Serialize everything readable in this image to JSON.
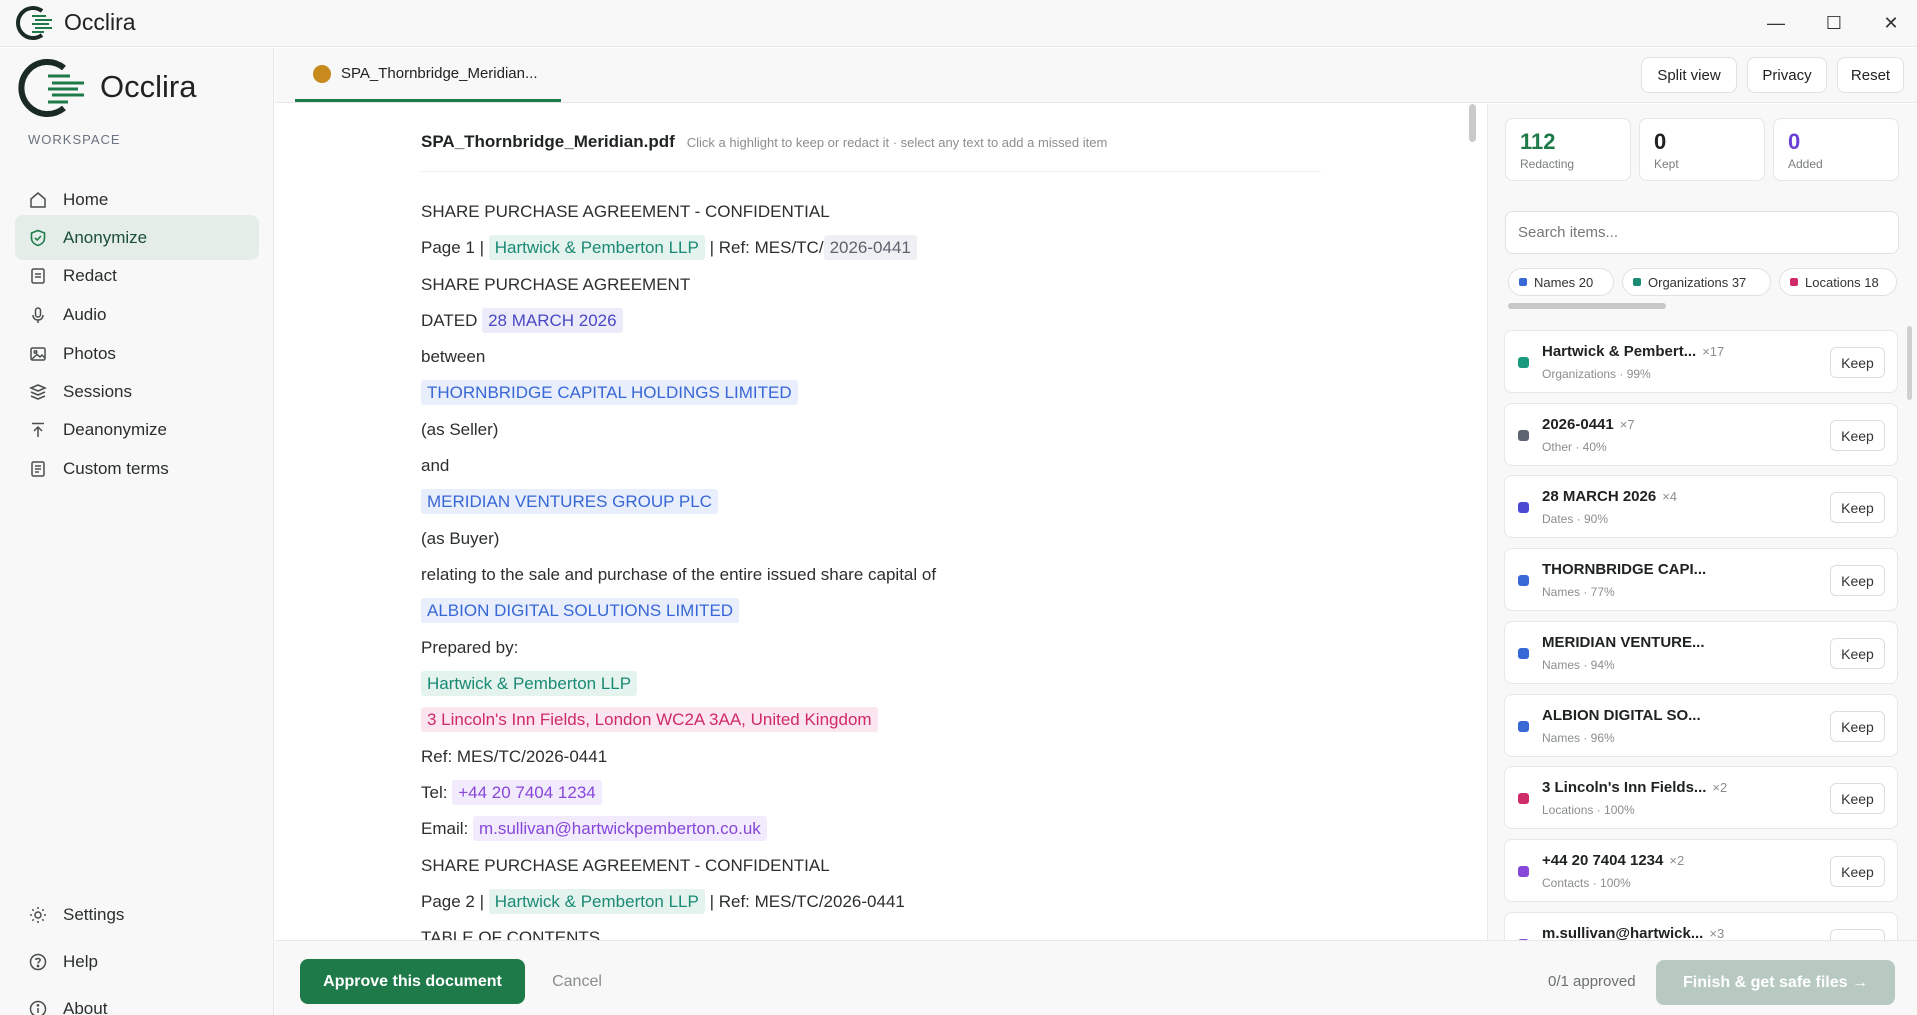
{
  "app": {
    "title": "Occlira"
  },
  "window_controls": {
    "minimize": "—",
    "maximize": "☐",
    "close": "✕"
  },
  "sidebar": {
    "brand": "Occlira",
    "section_label": "WORKSPACE",
    "nav": [
      {
        "label": "Home",
        "icon": "home-icon"
      },
      {
        "label": "Anonymize",
        "icon": "shield-icon",
        "active": true
      },
      {
        "label": "Redact",
        "icon": "document-icon"
      },
      {
        "label": "Audio",
        "icon": "microphone-icon"
      },
      {
        "label": "Photos",
        "icon": "image-icon"
      },
      {
        "label": "Sessions",
        "icon": "stack-icon"
      },
      {
        "label": "Deanonymize",
        "icon": "upload-icon"
      },
      {
        "label": "Custom terms",
        "icon": "list-icon"
      }
    ],
    "bottom": [
      {
        "label": "Settings",
        "icon": "sun-icon"
      },
      {
        "label": "Help",
        "icon": "help-icon"
      },
      {
        "label": "About",
        "icon": "info-icon"
      }
    ]
  },
  "tabs": {
    "active_doc": "SPA_Thornbridge_Meridian...",
    "dot_color": "#c98a1d"
  },
  "top_actions": {
    "split_view": "Split view",
    "privacy": "Privacy",
    "reset": "Reset"
  },
  "document": {
    "filename": "SPA_Thornbridge_Meridian.pdf",
    "hint": "Click a highlight to keep or redact it · select any text to add a missed item",
    "lines": [
      "SHARE PURCHASE AGREEMENT - CONFIDENTIAL",
      {
        "pre": "Page 1 | ",
        "org": "Hartwick & Pemberton LLP",
        "mid": " | Ref: MES/TC/",
        "other": "2026-0441"
      },
      "SHARE PURCHASE AGREEMENT",
      {
        "pre": "DATED ",
        "date": "28 MARCH 2026"
      },
      "between",
      {
        "name": "THORNBRIDGE CAPITAL HOLDINGS LIMITED"
      },
      "(as Seller)",
      "and",
      {
        "name": "MERIDIAN VENTURES GROUP PLC"
      },
      "(as Buyer)",
      "relating to the sale and purchase of the entire issued share capital of",
      {
        "name": "ALBION DIGITAL SOLUTIONS LIMITED"
      },
      "Prepared by:",
      {
        "org": "Hartwick & Pemberton LLP"
      },
      {
        "loc": "3 Lincoln's Inn Fields, London WC2A 3AA, United Kingdom"
      },
      "Ref: MES/TC/2026-0441",
      {
        "pre": "Tel: ",
        "contact": "+44 20 7404 1234"
      },
      {
        "pre": "Email: ",
        "contact": "m.sullivan@hartwickpemberton.co.uk"
      },
      "SHARE PURCHASE AGREEMENT - CONFIDENTIAL",
      {
        "pre": "Page 2 | ",
        "org": "Hartwick & Pemberton LLP",
        "mid": " | Ref: MES/TC/2026-0441"
      },
      "TABLE OF CONTENTS"
    ]
  },
  "stats": {
    "redacting": {
      "value": "112",
      "label": "Redacting",
      "color": "#1f7a4a"
    },
    "kept": {
      "value": "0",
      "label": "Kept",
      "color": "#222222"
    },
    "added": {
      "value": "0",
      "label": "Added",
      "color": "#6a3fd6"
    }
  },
  "search": {
    "placeholder": "Search items..."
  },
  "chips": [
    {
      "label": "Names 20",
      "color": "#3867d6"
    },
    {
      "label": "Organizations 37",
      "color": "#1a8a74"
    },
    {
      "label": "Locations 18",
      "color": "#cf2a6a"
    }
  ],
  "items": [
    {
      "title": "Hartwick & Pembert...",
      "count": "×17",
      "meta": "Organizations · 99%",
      "color": "#1a9a7c",
      "action": "Keep"
    },
    {
      "title": "2026-0441",
      "count": "×7",
      "meta": "Other · 40%",
      "color": "#5d6470",
      "action": "Keep"
    },
    {
      "title": "28 MARCH 2026",
      "count": "×4",
      "meta": "Dates · 90%",
      "color": "#4b48d4",
      "action": "Keep"
    },
    {
      "title": "THORNBRIDGE CAPI...",
      "count": "",
      "meta": "Names · 77%",
      "color": "#3867d6",
      "action": "Keep"
    },
    {
      "title": "MERIDIAN VENTURE...",
      "count": "",
      "meta": "Names · 94%",
      "color": "#3867d6",
      "action": "Keep"
    },
    {
      "title": "ALBION DIGITAL SO...",
      "count": "",
      "meta": "Names · 96%",
      "color": "#3867d6",
      "action": "Keep"
    },
    {
      "title": "3 Lincoln's Inn Fields...",
      "count": "×2",
      "meta": "Locations · 100%",
      "color": "#cf2a6a",
      "action": "Keep"
    },
    {
      "title": "+44 20 7404 1234",
      "count": "×2",
      "meta": "Contacts · 100%",
      "color": "#8747d8",
      "action": "Keep"
    },
    {
      "title": "m.sullivan@hartwick...",
      "count": "×3",
      "meta": "",
      "color": "#8747d8",
      "action": "Keep"
    }
  ],
  "footer": {
    "approve": "Approve this document",
    "cancel": "Cancel",
    "approved_status": "0/1 approved",
    "finish": "Finish & get safe files →"
  }
}
